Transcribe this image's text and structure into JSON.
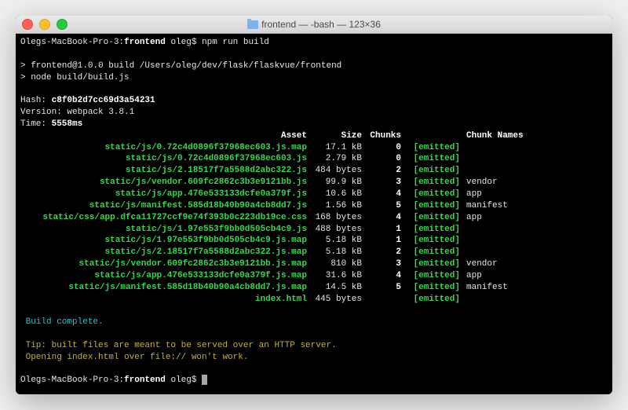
{
  "title": "frontend — -bash — 123×36",
  "prompt_host": "Olegs-MacBook-Pro-3:",
  "prompt_dir": "frontend",
  "prompt_user": "oleg$",
  "command": "npm run build",
  "script_lines": [
    "> frontend@1.0.0 build /Users/oleg/dev/flask/flaskvue/frontend",
    "> node build/build.js"
  ],
  "hash_label": "Hash: ",
  "hash": "c8f0b2d7cc69d3a54231",
  "version_label": "Version: ",
  "version": "webpack 3.8.1",
  "time_label": "Time: ",
  "time": "5558ms",
  "headers": {
    "asset": "Asset",
    "size": "Size",
    "chunks": "Chunks",
    "names": "Chunk Names"
  },
  "rows": [
    {
      "asset": "static/js/0.72c4d0896f37968ec603.js.map",
      "size": "17.1 kB",
      "chunks": "0",
      "emitted": "[emitted]",
      "names": ""
    },
    {
      "asset": "static/js/0.72c4d0896f37968ec603.js",
      "size": "2.79 kB",
      "chunks": "0",
      "emitted": "[emitted]",
      "names": ""
    },
    {
      "asset": "static/js/2.18517f7a5588d2abc322.js",
      "size": "484 bytes",
      "chunks": "2",
      "emitted": "[emitted]",
      "names": ""
    },
    {
      "asset": "static/js/vendor.609fc2862c3b3e9121bb.js",
      "size": "99.9 kB",
      "chunks": "3",
      "emitted": "[emitted]",
      "names": "vendor"
    },
    {
      "asset": "static/js/app.476e533133dcfe0a379f.js",
      "size": "10.6 kB",
      "chunks": "4",
      "emitted": "[emitted]",
      "names": "app"
    },
    {
      "asset": "static/js/manifest.585d18b40b90a4cb8dd7.js",
      "size": "1.56 kB",
      "chunks": "5",
      "emitted": "[emitted]",
      "names": "manifest"
    },
    {
      "asset": "static/css/app.dfca11727ccf9e74f393b0c223db19ce.css",
      "size": "168 bytes",
      "chunks": "4",
      "emitted": "[emitted]",
      "names": "app"
    },
    {
      "asset": "static/js/1.97e553f9bb0d505cb4c9.js",
      "size": "488 bytes",
      "chunks": "1",
      "emitted": "[emitted]",
      "names": ""
    },
    {
      "asset": "static/js/1.97e553f9bb0d505cb4c9.js.map",
      "size": "5.18 kB",
      "chunks": "1",
      "emitted": "[emitted]",
      "names": ""
    },
    {
      "asset": "static/js/2.18517f7a5588d2abc322.js.map",
      "size": "5.18 kB",
      "chunks": "2",
      "emitted": "[emitted]",
      "names": ""
    },
    {
      "asset": "static/js/vendor.609fc2862c3b3e9121bb.js.map",
      "size": "810 kB",
      "chunks": "3",
      "emitted": "[emitted]",
      "names": "vendor"
    },
    {
      "asset": "static/js/app.476e533133dcfe0a379f.js.map",
      "size": "31.6 kB",
      "chunks": "4",
      "emitted": "[emitted]",
      "names": "app"
    },
    {
      "asset": "static/js/manifest.585d18b40b90a4cb8dd7.js.map",
      "size": "14.5 kB",
      "chunks": "5",
      "emitted": "[emitted]",
      "names": "manifest"
    },
    {
      "asset": "index.html",
      "size": "445 bytes",
      "chunks": "",
      "emitted": "[emitted]",
      "names": ""
    }
  ],
  "build_complete": " Build complete.",
  "tip1": " Tip: built files are meant to be served over an HTTP server.",
  "tip2": " Opening index.html over file:// won't work.",
  "prompt2_host": "Olegs-MacBook-Pro-3:",
  "prompt2_dir": "frontend",
  "prompt2_user": "oleg$"
}
